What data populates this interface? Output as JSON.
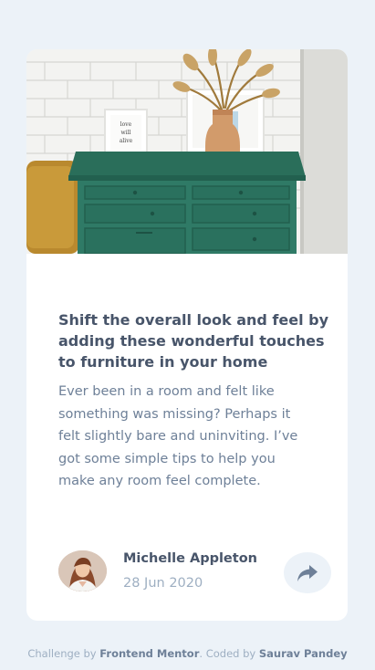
{
  "article": {
    "image_alt": "Green drawer cabinet with a vase of dried grass and a framed print",
    "title": "Shift the overall look and feel by adding these wonderful touches to furniture in your home",
    "description": "Ever been in a room and felt like something was missing? Perhaps it felt slightly bare and uninviting. I’ve got some simple tips to help you make any room feel complete."
  },
  "author": {
    "name": "Michelle Appleton",
    "date": "28 Jun 2020",
    "avatar_icon": "avatar-photo"
  },
  "share": {
    "icon": "share-icon"
  },
  "footer": {
    "prefix": "Challenge by ",
    "challenge_link": "Frontend Mentor",
    "middle": ". Coded by ",
    "coder_link": "Saurav Pandey"
  },
  "colors": {
    "background": "#ecf2f8",
    "heading": "#48556a",
    "body_text": "#6e8098",
    "muted": "#9eafc2",
    "drawer_green": "#2f7a66"
  }
}
